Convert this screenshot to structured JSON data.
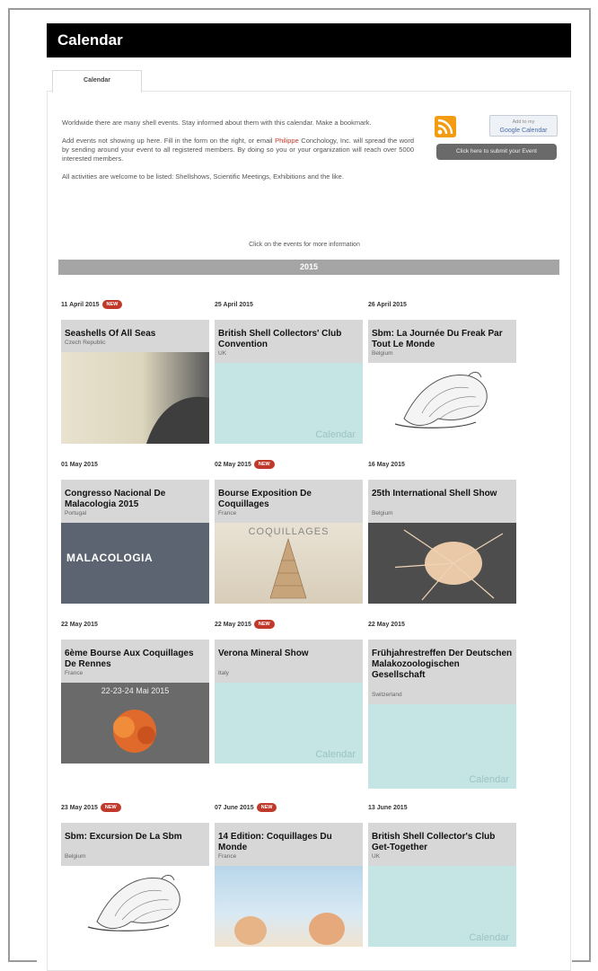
{
  "page": {
    "title": "Calendar",
    "tab": "Calendar"
  },
  "intro": {
    "p1": "Worldwide there are many shell events. Stay informed about them with this calendar. Make a bookmark.",
    "p2_a": "Add events not showing up here. Fill in the form on the right, or email ",
    "p2_link": "Philippe",
    "p2_b": " Conchology, Inc. will spread the word by sending around your event to all registered members. By doing so you or your organization will reach over 5000 interested members.",
    "p3": "All activities are welcome to be listed: Shellshows, Scientific Meetings, Exhibitions and the like."
  },
  "side": {
    "gcal_small": "Add to my",
    "gcal_label": "Google Calendar",
    "submit_label": "Click here to submit your Event"
  },
  "hint": "Click on the events for more information",
  "year": "2015",
  "new_badge": "NEW",
  "colors": {
    "accent": "#c0392b",
    "card_bg": "#d7d7d7",
    "placeholder": "#c4e5e3",
    "rss": "#f39c12"
  },
  "events": [
    {
      "date": "11 April 2015",
      "new": true,
      "title": "Seashells Of All Seas",
      "country": "Czech Republic",
      "image": "poster"
    },
    {
      "date": "25 April 2015",
      "new": false,
      "title": "British Shell Collectors' Club Convention",
      "country": "UK",
      "image": "placeholder",
      "watermark": "Calendar"
    },
    {
      "date": "26 April 2015",
      "new": false,
      "title": "Sbm: La Journée Du Freak Par Tout Le Monde",
      "country": "Belgium",
      "image": "shell-drawing"
    },
    {
      "date": "01 May 2015",
      "new": false,
      "title": "Congresso Nacional De Malacologia 2015",
      "country": "Portugal",
      "image": "malacologia",
      "image_text": "MALACOLOGIA"
    },
    {
      "date": "02 May 2015",
      "new": true,
      "title": "Bourse Exposition De Coquillages",
      "country": "France",
      "image": "coquillages",
      "image_text": "COQUILLAGES"
    },
    {
      "date": "16 May 2015",
      "new": false,
      "title": "25th International Shell Show",
      "country": "Belgium",
      "image": "murex"
    },
    {
      "date": "22 May 2015",
      "new": false,
      "title": "6ème Bourse Aux Coquillages De Rennes",
      "country": "France",
      "image": "rennes",
      "image_text": "22-23-24 Mai 2015"
    },
    {
      "date": "22 May 2015",
      "new": true,
      "title": "Verona Mineral Show",
      "country": "Italy",
      "image": "placeholder",
      "watermark": "Calendar"
    },
    {
      "date": "22 May 2015",
      "new": false,
      "title": "Frühjahrestreffen Der Deutschen Malakozoologischen Gesellschaft",
      "country": "Switzerland",
      "image": "placeholder",
      "watermark": "Calendar"
    },
    {
      "date": "23 May 2015",
      "new": true,
      "title": "Sbm: Excursion De La Sbm",
      "country": "Belgium",
      "image": "shell-drawing"
    },
    {
      "date": "07 June 2015",
      "new": true,
      "title": "14 Edition: Coquillages Du Monde",
      "country": "France",
      "image": "monde"
    },
    {
      "date": "13 June 2015",
      "new": false,
      "title": "British Shell Collector's Club Get-Together",
      "country": "UK",
      "image": "placeholder",
      "watermark": "Calendar"
    }
  ]
}
